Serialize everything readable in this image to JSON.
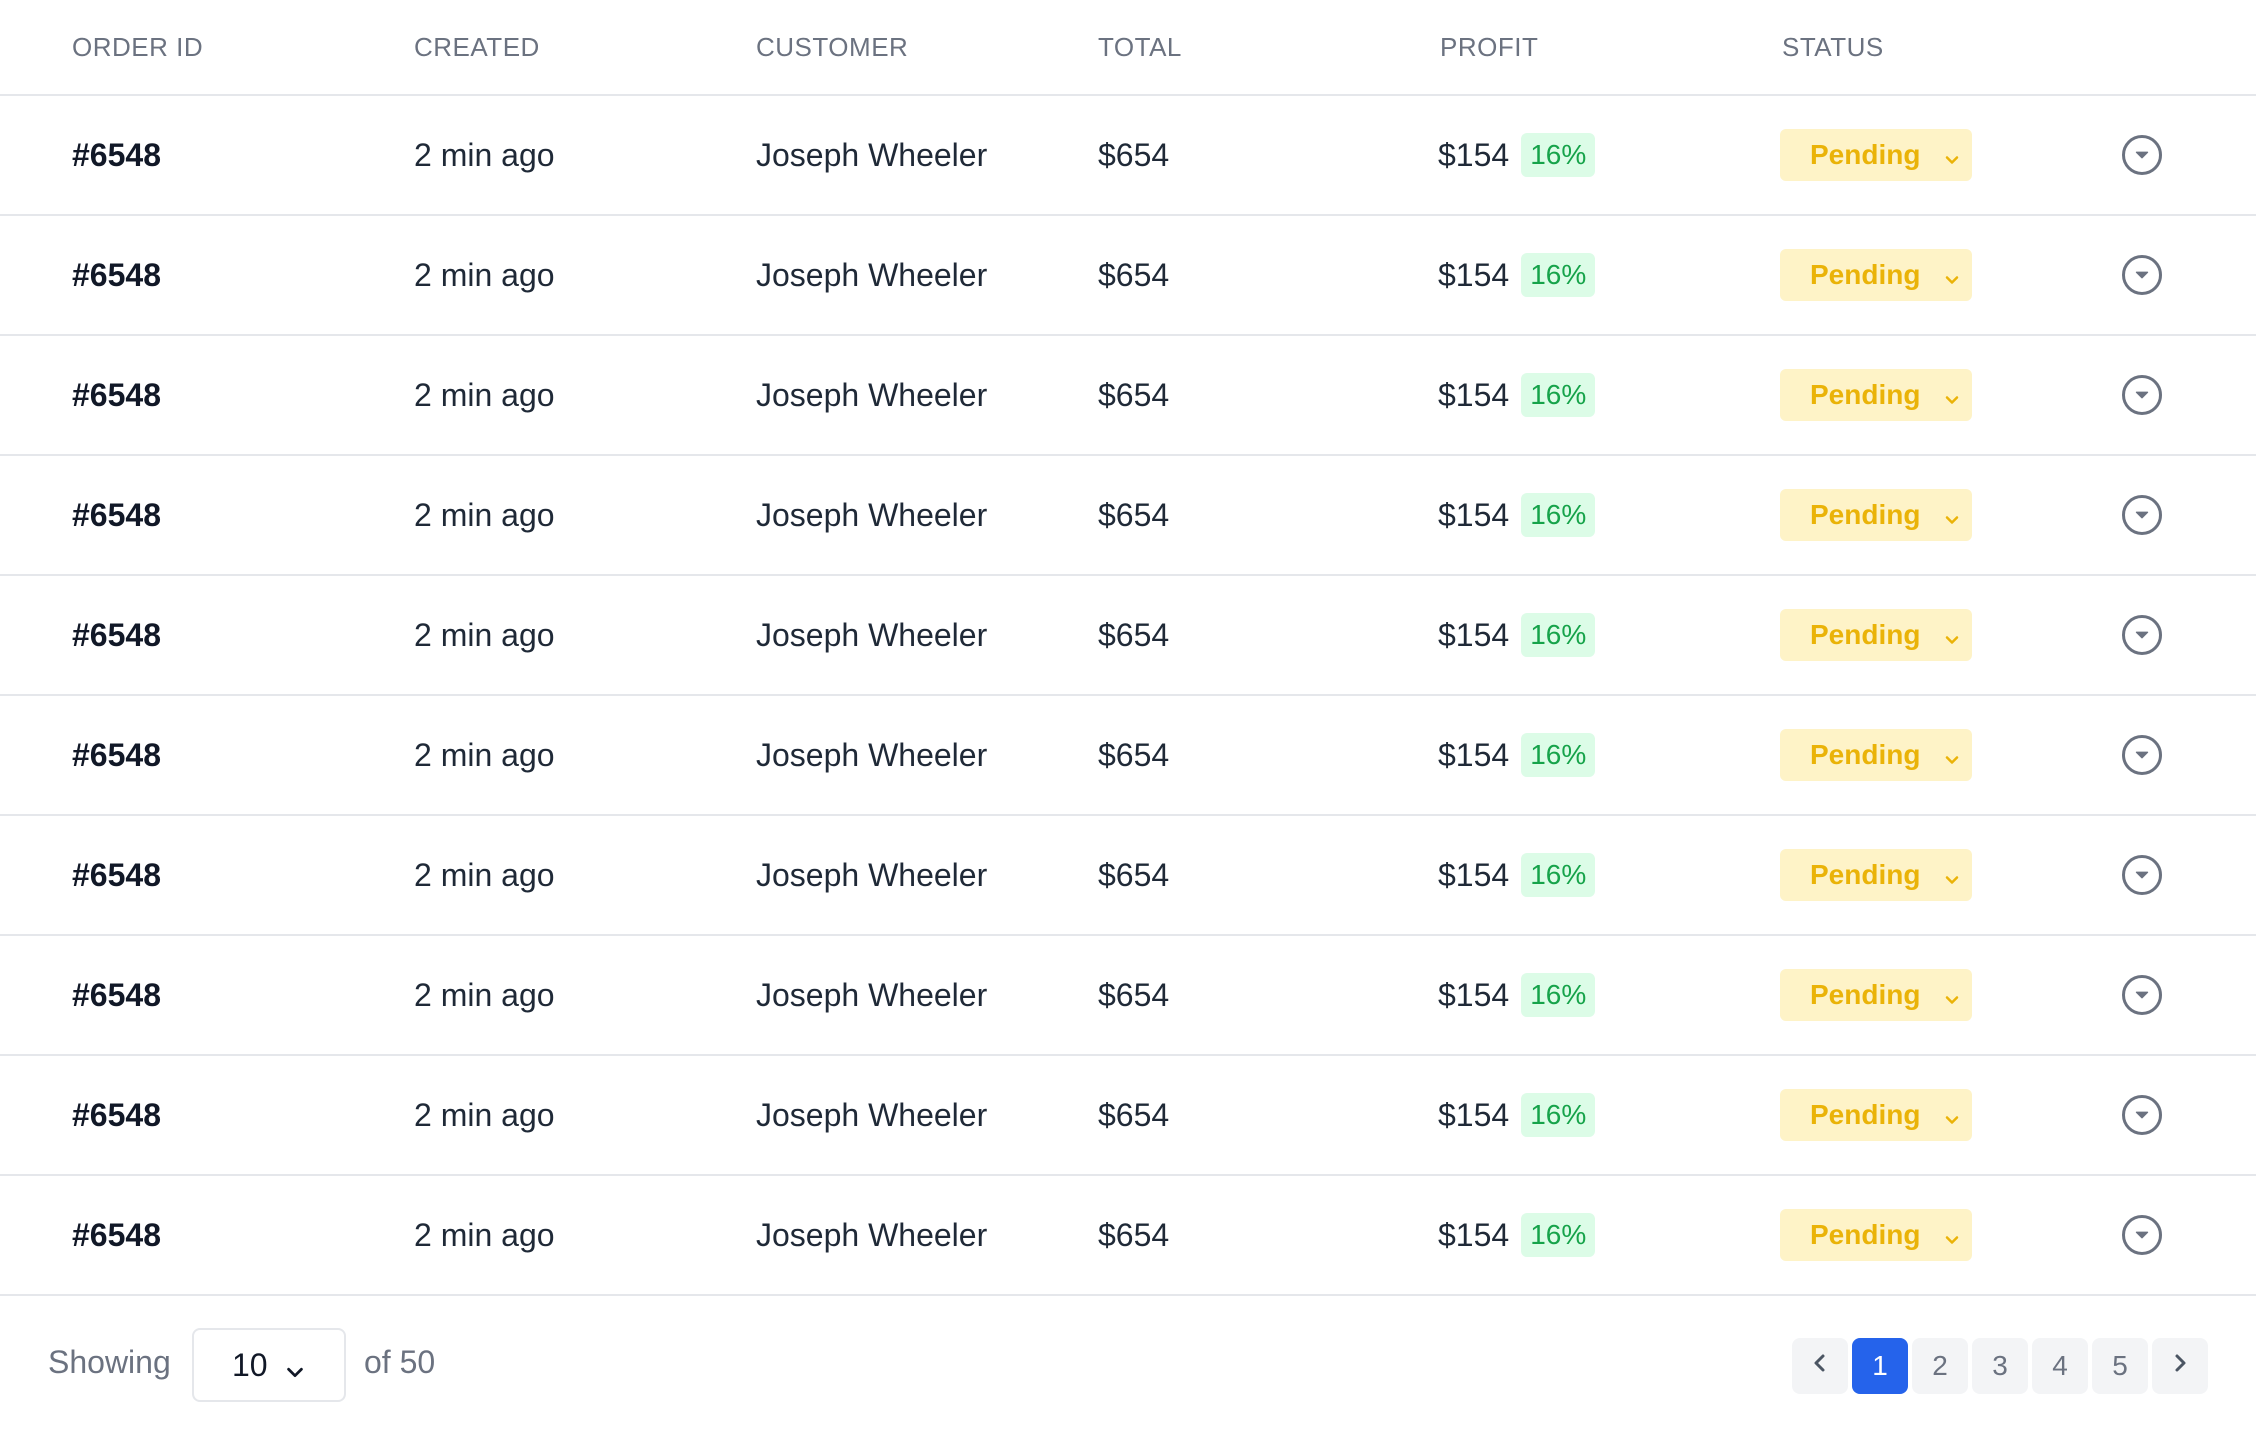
{
  "table": {
    "headers": [
      "ORDER ID",
      "CREATED",
      "CUSTOMER",
      "TOTAL",
      "PROFIT",
      "STATUS"
    ],
    "rows": [
      {
        "order_id": "#6548",
        "created": "2 min ago",
        "customer": "Joseph Wheeler",
        "total": "$654",
        "profit": "$154",
        "profit_pct": "16%",
        "status": "Pending"
      },
      {
        "order_id": "#6548",
        "created": "2 min ago",
        "customer": "Joseph Wheeler",
        "total": "$654",
        "profit": "$154",
        "profit_pct": "16%",
        "status": "Pending"
      },
      {
        "order_id": "#6548",
        "created": "2 min ago",
        "customer": "Joseph Wheeler",
        "total": "$654",
        "profit": "$154",
        "profit_pct": "16%",
        "status": "Pending"
      },
      {
        "order_id": "#6548",
        "created": "2 min ago",
        "customer": "Joseph Wheeler",
        "total": "$654",
        "profit": "$154",
        "profit_pct": "16%",
        "status": "Pending"
      },
      {
        "order_id": "#6548",
        "created": "2 min ago",
        "customer": "Joseph Wheeler",
        "total": "$654",
        "profit": "$154",
        "profit_pct": "16%",
        "status": "Pending"
      },
      {
        "order_id": "#6548",
        "created": "2 min ago",
        "customer": "Joseph Wheeler",
        "total": "$654",
        "profit": "$154",
        "profit_pct": "16%",
        "status": "Pending"
      },
      {
        "order_id": "#6548",
        "created": "2 min ago",
        "customer": "Joseph Wheeler",
        "total": "$654",
        "profit": "$154",
        "profit_pct": "16%",
        "status": "Pending"
      },
      {
        "order_id": "#6548",
        "created": "2 min ago",
        "customer": "Joseph Wheeler",
        "total": "$654",
        "profit": "$154",
        "profit_pct": "16%",
        "status": "Pending"
      },
      {
        "order_id": "#6548",
        "created": "2 min ago",
        "customer": "Joseph Wheeler",
        "total": "$654",
        "profit": "$154",
        "profit_pct": "16%",
        "status": "Pending"
      },
      {
        "order_id": "#6548",
        "created": "2 min ago",
        "customer": "Joseph Wheeler",
        "total": "$654",
        "profit": "$154",
        "profit_pct": "16%",
        "status": "Pending"
      }
    ],
    "row_action_icon": "chevron-down-circle-icon",
    "status_dropdown_icon": "chevron-down-icon"
  },
  "footer": {
    "showing_label": "Showing",
    "page_size": "10",
    "page_size_icon": "chevron-down-icon",
    "of_label": "of 50",
    "pagination": {
      "prev_icon": "chevron-left-icon",
      "next_icon": "chevron-right-icon",
      "pages": [
        "1",
        "2",
        "3",
        "4",
        "5"
      ],
      "active_page": "1"
    }
  },
  "colors": {
    "status_bg": "#fef3c7",
    "status_text": "#eab308",
    "profit_badge_bg": "#dcfce7",
    "profit_badge_text": "#16a34a",
    "active_page": "#2563eb",
    "border": "#e5e7eb"
  }
}
